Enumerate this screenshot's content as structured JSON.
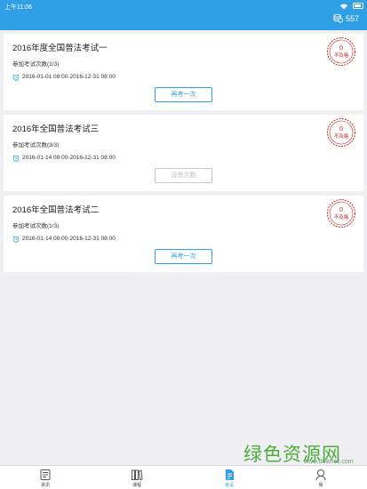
{
  "status_bar": {
    "time": "上午11:06"
  },
  "header": {
    "coin_count": "557"
  },
  "exams": [
    {
      "title": "2016年度全国普法考试一",
      "attempts": "参加考试次数(1/3)",
      "period": "2016-01-01 08:00-2016-12-31 08:00",
      "button_label": "再考一次",
      "button_enabled": true,
      "score": "0",
      "result": "不及格"
    },
    {
      "title": "2016年全国普法考试三",
      "attempts": "参加考试次数(3/3)",
      "period": "2016-01-14 08:00-2016-12-31 08:00",
      "button_label": "没有次数",
      "button_enabled": false,
      "score": "0",
      "result": "不及格"
    },
    {
      "title": "2016年全国普法考试二",
      "attempts": "参加考试次数(1/3)",
      "period": "2016-01-14 08:00-2016-12-31 08:00",
      "button_label": "再考一次",
      "button_enabled": true,
      "score": "0",
      "result": "不及格"
    }
  ],
  "watermark": {
    "title": "绿色资源网",
    "url": "www.downcc.com"
  },
  "tabbar": {
    "items": [
      {
        "label": "资讯",
        "icon": "news-icon"
      },
      {
        "label": "课程",
        "icon": "books-icon"
      },
      {
        "label": "考试",
        "icon": "exam-icon",
        "active": true
      },
      {
        "label": "我",
        "icon": "profile-icon"
      }
    ]
  },
  "colors": {
    "primary": "#2f9fe6",
    "stamp": "#c62828",
    "background": "#efeff4"
  }
}
